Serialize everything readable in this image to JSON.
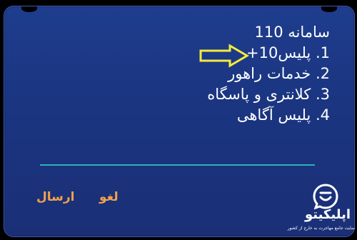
{
  "dialog": {
    "title": "سامانه 110",
    "options": [
      {
        "number": "1.",
        "label": "پلیس10+"
      },
      {
        "number": "2.",
        "label": "خدمات راهور"
      },
      {
        "number": "3.",
        "label": "کلانتری و پاسگاه"
      },
      {
        "number": "4.",
        "label": "پلیس آگاهی"
      }
    ],
    "highlighted_option": 1,
    "divider_color": "#29b3b8"
  },
  "softkeys": {
    "cancel_label": "لغو",
    "send_label": "ارسال",
    "color": "#f2a24a"
  },
  "watermark": {
    "name": "اپلیکیتو",
    "tagline": "سایت جامع مهاجرت به خارج از کشور",
    "icon": "chat-smile-icon"
  },
  "colors": {
    "dialog_background": "#1d3886",
    "text": "#ffffff",
    "arrow": "#f3ec3a"
  }
}
